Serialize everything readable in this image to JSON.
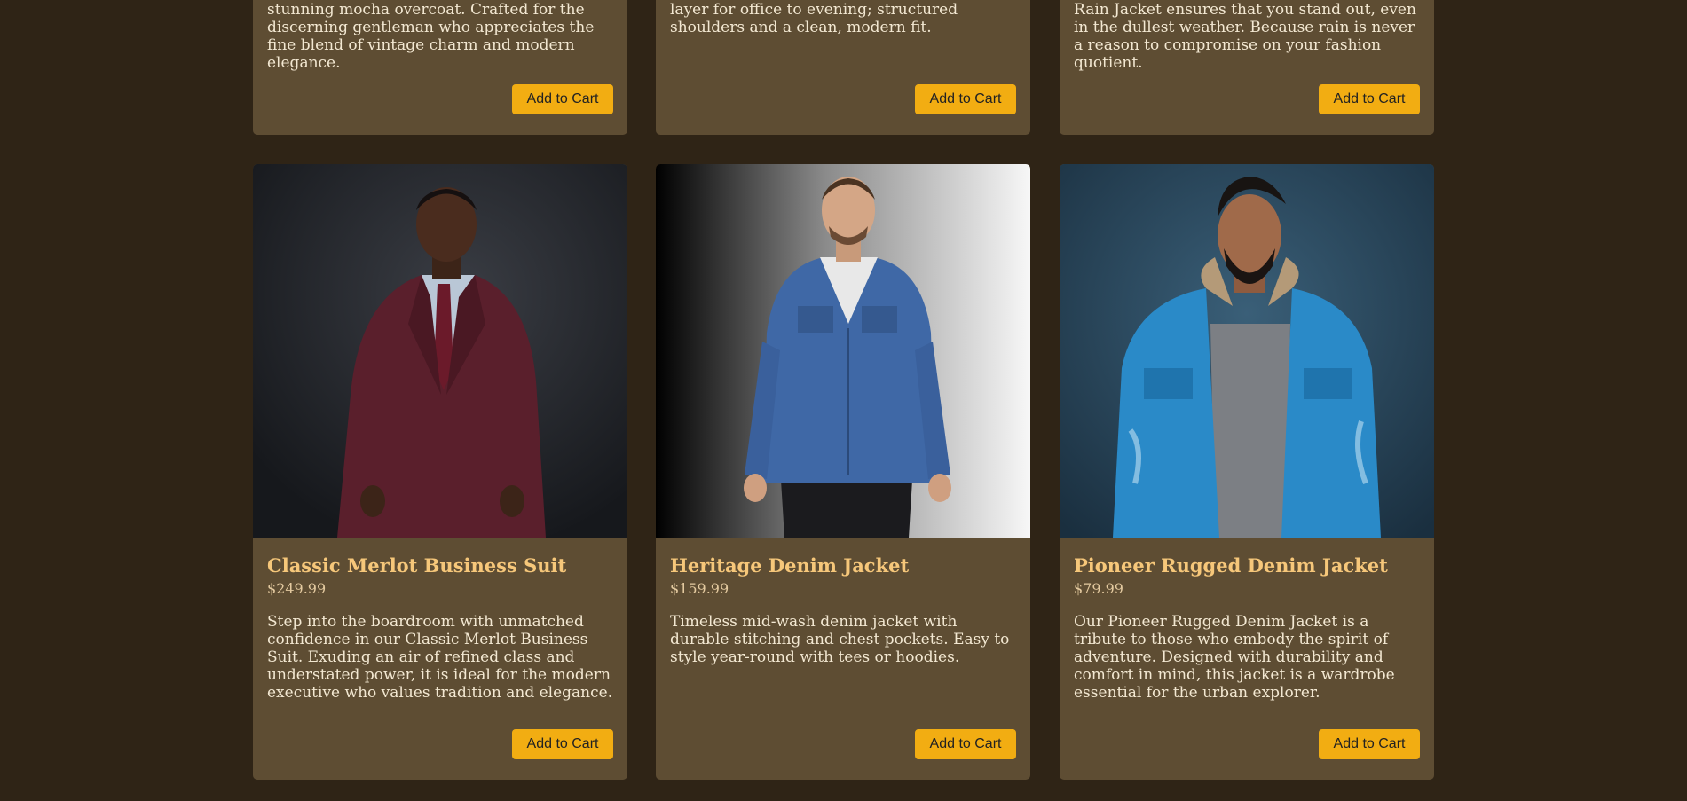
{
  "products_top": [
    {
      "description": "stunning mocha overcoat. Crafted for the discerning gentleman who appreciates the fine blend of vintage charm and modern elegance.",
      "cta": "Add to Cart"
    },
    {
      "description": "layer for office to evening; structured shoulders and a clean, modern fit.",
      "cta": "Add to Cart"
    },
    {
      "description": "Rain Jacket ensures that you stand out, even in the dullest weather. Because rain is never a reason to compromise on your fashion quotient.",
      "cta": "Add to Cart"
    }
  ],
  "products": [
    {
      "title": "Classic Merlot Business Suit",
      "price": "$249.99",
      "description": "Step into the boardroom with unmatched confidence in our Classic Merlot Business Suit. Exuding an air of refined class and understated power, it is ideal for the modern executive who values tradition and elegance.",
      "cta": "Add to Cart"
    },
    {
      "title": "Heritage Denim Jacket",
      "price": "$159.99",
      "description": "Timeless mid-wash denim jacket with durable stitching and chest pockets. Easy to style year-round with tees or hoodies.",
      "cta": "Add to Cart"
    },
    {
      "title": "Pioneer Rugged Denim Jacket",
      "price": "$79.99",
      "description": "Our Pioneer Rugged Denim Jacket is a tribute to those who embody the spirit of adventure. Designed with durability and comfort in mind, this jacket is a wardrobe essential for the urban explorer.",
      "cta": "Add to Cart"
    }
  ],
  "colors": {
    "page_bg": "#2f2416",
    "card_bg": "#5e4d33",
    "title": "#f6c77a",
    "button": "#f2ad12"
  }
}
